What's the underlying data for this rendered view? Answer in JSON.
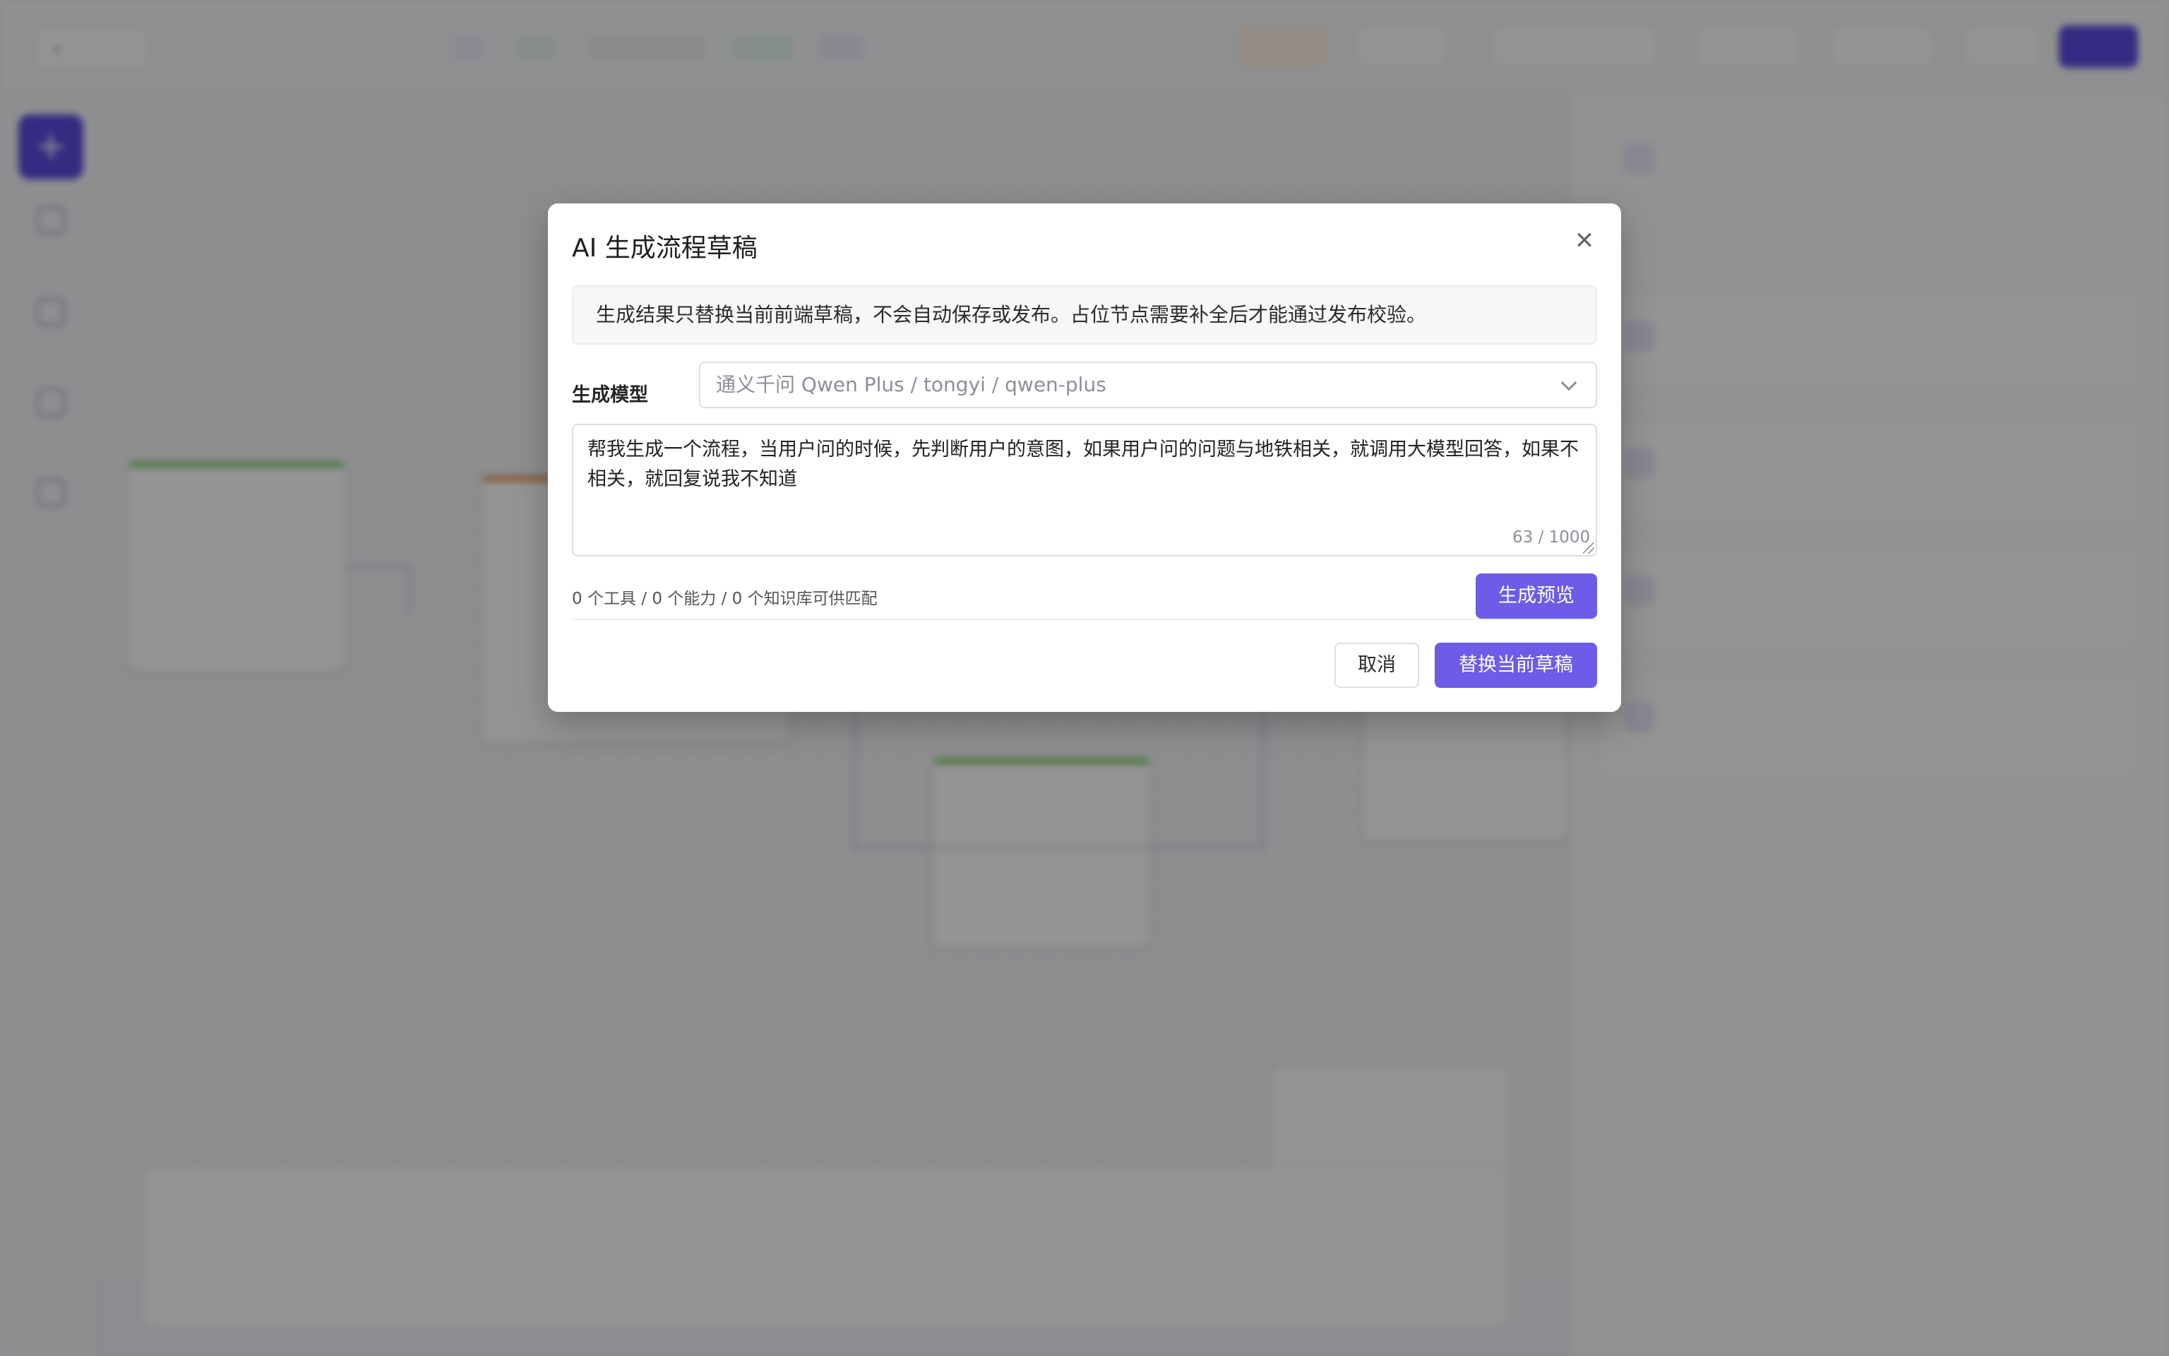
{
  "modal": {
    "title": "AI 生成流程草稿",
    "close_icon": "close-icon",
    "notice": "生成结果只替换当前前端草稿，不会自动保存或发布。占位节点需要补全后才能通过发布校验。",
    "model_label": "生成模型",
    "model_value": "通义千问 Qwen Plus / tongyi / qwen-plus",
    "prompt_value": "帮我生成一个流程，当用户问的时候，先判断用户的意图，如果用户问的问题与地铁相关，就调用大模型回答，如果不相关，就回复说我不知道",
    "char_count": "63 / 1000",
    "resource_summary": "0 个工具 / 0 个能力 / 0 个知识库可供匹配",
    "generate_button": "生成预览",
    "cancel_button": "取消",
    "replace_button": "替换当前草稿"
  },
  "colors": {
    "primary": "#6c5ce7",
    "overlay": "rgba(0,0,0,0.42)"
  }
}
